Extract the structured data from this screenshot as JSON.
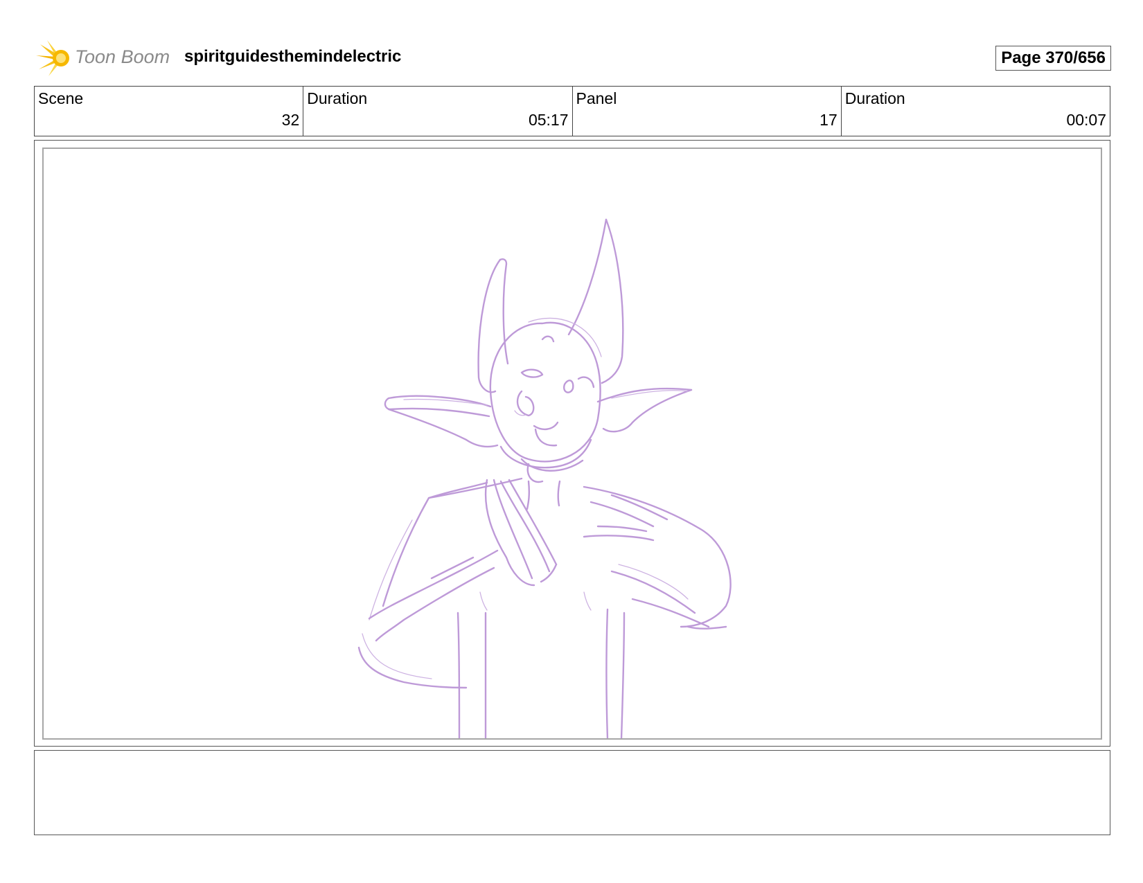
{
  "header": {
    "logo_text": "Toon Boom",
    "project_title": "spiritguidesthemindelectric",
    "page_label": "Page 370/656"
  },
  "info": [
    {
      "label": "Scene",
      "value": "32"
    },
    {
      "label": "Duration",
      "value": "05:17"
    },
    {
      "label": "Panel",
      "value": "17"
    },
    {
      "label": "Duration",
      "value": "00:07"
    }
  ],
  "panel": {
    "sketch_color": "#be9ad8",
    "content": "creature-sketch"
  },
  "notes": {
    "text": ""
  }
}
